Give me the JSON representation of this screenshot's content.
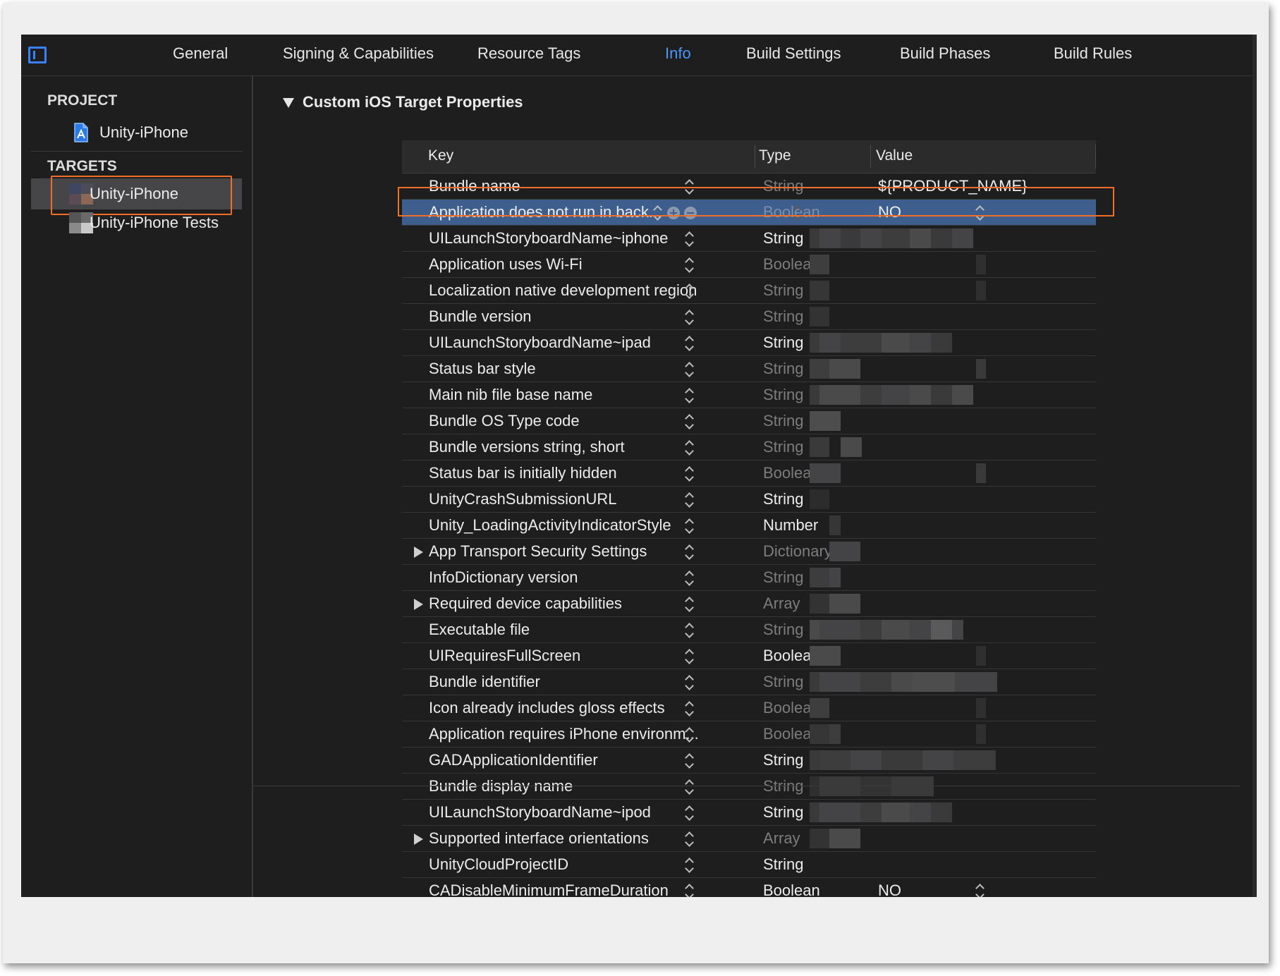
{
  "tabs": [
    {
      "label": "General",
      "active": false
    },
    {
      "label": "Signing & Capabilities",
      "active": false
    },
    {
      "label": "Resource Tags",
      "active": false
    },
    {
      "label": "Info",
      "active": true
    },
    {
      "label": "Build Settings",
      "active": false
    },
    {
      "label": "Build Phases",
      "active": false
    },
    {
      "label": "Build Rules",
      "active": false
    }
  ],
  "sidebar": {
    "project_header": "PROJECT",
    "project_item": "Unity-iPhone",
    "targets_header": "TARGETS",
    "targets": [
      {
        "label": "Unity-iPhone",
        "selected": true
      },
      {
        "label": "Unity-iPhone Tests",
        "selected": false
      }
    ]
  },
  "section": {
    "title": "Custom iOS Target Properties"
  },
  "table": {
    "headers": {
      "key": "Key",
      "type": "Type",
      "value": "Value"
    },
    "rows": [
      {
        "key": "Bundle name",
        "type": "String",
        "type_dim": true,
        "value": "${PRODUCT_NAME}"
      },
      {
        "key": "Application does not run in back...",
        "type": "Boolean",
        "type_dim": true,
        "value": "NO",
        "selected": true
      },
      {
        "key": "UILaunchStoryboardName~iphone",
        "type": "String",
        "type_dim": false,
        "value": ""
      },
      {
        "key": "Application uses Wi-Fi",
        "type": "Boolean",
        "type_dim": true,
        "value": ""
      },
      {
        "key": "Localization native development region",
        "type": "String",
        "type_dim": true,
        "value": ""
      },
      {
        "key": "Bundle version",
        "type": "String",
        "type_dim": true,
        "value": ""
      },
      {
        "key": "UILaunchStoryboardName~ipad",
        "type": "String",
        "type_dim": false,
        "value": ""
      },
      {
        "key": "Status bar style",
        "type": "String",
        "type_dim": true,
        "value": ""
      },
      {
        "key": "Main nib file base name",
        "type": "String",
        "type_dim": true,
        "value": ""
      },
      {
        "key": "Bundle OS Type code",
        "type": "String",
        "type_dim": true,
        "value": ""
      },
      {
        "key": "Bundle versions string, short",
        "type": "String",
        "type_dim": true,
        "value": ""
      },
      {
        "key": "Status bar is initially hidden",
        "type": "Boolean",
        "type_dim": true,
        "value": ""
      },
      {
        "key": "UnityCrashSubmissionURL",
        "type": "String",
        "type_dim": false,
        "value": ""
      },
      {
        "key": "Unity_LoadingActivityIndicatorStyle",
        "type": "Number",
        "type_dim": false,
        "value": ""
      },
      {
        "key": "App Transport Security Settings",
        "type": "Dictionary",
        "type_dim": true,
        "value": "",
        "expandable": true
      },
      {
        "key": "InfoDictionary version",
        "type": "String",
        "type_dim": true,
        "value": ""
      },
      {
        "key": "Required device capabilities",
        "type": "Array",
        "type_dim": true,
        "value": "",
        "expandable": true
      },
      {
        "key": "Executable file",
        "type": "String",
        "type_dim": true,
        "value": ""
      },
      {
        "key": "UIRequiresFullScreen",
        "type": "Boolean",
        "type_dim": false,
        "value": ""
      },
      {
        "key": "Bundle identifier",
        "type": "String",
        "type_dim": true,
        "value": ""
      },
      {
        "key": "Icon already includes gloss effects",
        "type": "Boolean",
        "type_dim": true,
        "value": ""
      },
      {
        "key": "Application requires iPhone environm...",
        "type": "Boolean",
        "type_dim": true,
        "value": ""
      },
      {
        "key": "GADApplicationIdentifier",
        "type": "String",
        "type_dim": false,
        "value": ""
      },
      {
        "key": "Bundle display name",
        "type": "String",
        "type_dim": true,
        "value": ""
      },
      {
        "key": "UILaunchStoryboardName~ipod",
        "type": "String",
        "type_dim": false,
        "value": ""
      },
      {
        "key": "Supported interface orientations",
        "type": "Array",
        "type_dim": true,
        "value": "",
        "expandable": true
      },
      {
        "key": "UnityCloudProjectID",
        "type": "String",
        "type_dim": false,
        "value": ""
      },
      {
        "key": "CADisableMinimumFrameDuration",
        "type": "Boolean",
        "type_dim": false,
        "value": "NO"
      }
    ]
  },
  "colors": {
    "accent": "#4d96f7",
    "highlight_outline": "#f06f28",
    "selected_row": "#3e5f8e"
  }
}
